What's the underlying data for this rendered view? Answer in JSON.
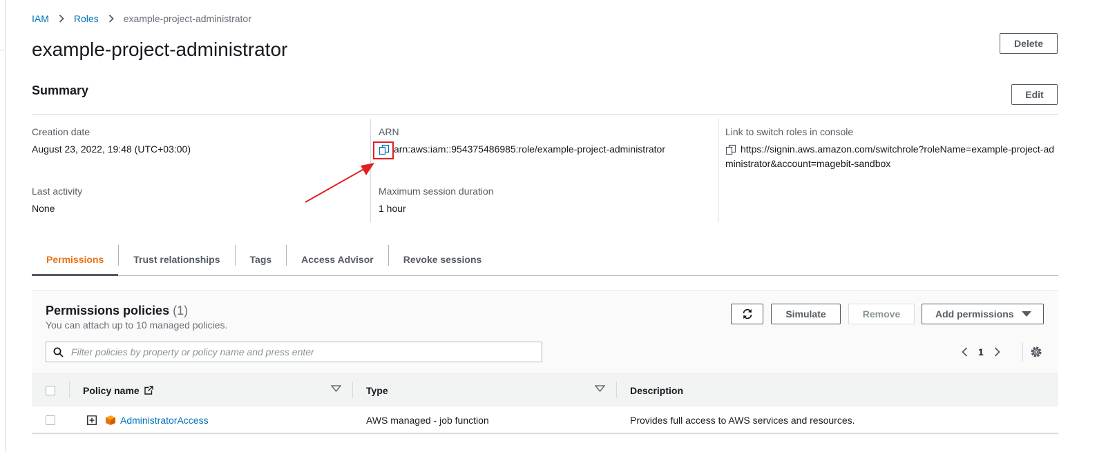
{
  "breadcrumb": {
    "items": [
      {
        "label": "IAM"
      },
      {
        "label": "Roles"
      }
    ],
    "current": "example-project-administrator"
  },
  "page": {
    "title": "example-project-administrator",
    "delete_label": "Delete"
  },
  "summary": {
    "title": "Summary",
    "edit_label": "Edit",
    "creation_date_label": "Creation date",
    "creation_date_value": "August 23, 2022, 19:48 (UTC+03:00)",
    "last_activity_label": "Last activity",
    "last_activity_value": "None",
    "arn_label": "ARN",
    "arn_value": "arn:aws:iam::954375486985:role/example-project-administrator",
    "max_session_label": "Maximum session duration",
    "max_session_value": "1 hour",
    "switch_link_label": "Link to switch roles in console",
    "switch_link_line1": "https://signin.aws.amazon.com/switchrole?roleName=example-project-ad",
    "switch_link_line2": "ministrator&account=magebit-sandbox"
  },
  "tabs": [
    {
      "label": "Permissions",
      "active": true
    },
    {
      "label": "Trust relationships"
    },
    {
      "label": "Tags"
    },
    {
      "label": "Access Advisor"
    },
    {
      "label": "Revoke sessions"
    }
  ],
  "permissions": {
    "title": "Permissions policies",
    "count": "(1)",
    "subtitle": "You can attach up to 10 managed policies.",
    "simulate_label": "Simulate",
    "remove_label": "Remove",
    "add_label": "Add permissions",
    "search_placeholder": "Filter policies by property or policy name and press enter",
    "page_number": "1",
    "columns": {
      "policy_name": "Policy name",
      "type": "Type",
      "description": "Description"
    },
    "rows": [
      {
        "policy_name": "AdministratorAccess",
        "type": "AWS managed - job function",
        "description": "Provides full access to AWS services and resources."
      }
    ]
  },
  "icons": {
    "accent": "#ec7211",
    "link": "#0073bb",
    "annotation": "#e02020"
  }
}
